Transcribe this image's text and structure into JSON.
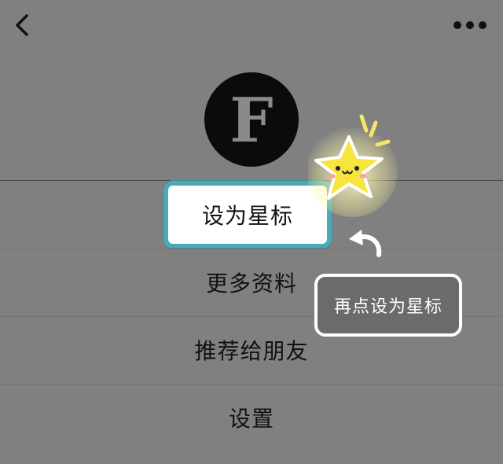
{
  "nav": {
    "back_icon": "chevron-left-icon",
    "more_icon": "ellipsis-icon"
  },
  "profile": {
    "avatar_letter": "F"
  },
  "menu": {
    "set_star": "设为星标",
    "more_info": "更多资料",
    "recommend": "推荐给朋友",
    "settings": "设置"
  },
  "hint": {
    "text": "再点设为星标"
  },
  "colors": {
    "background": "#808080",
    "highlight_border": "#4ea9b4",
    "star_yellow": "#f7e43c"
  }
}
